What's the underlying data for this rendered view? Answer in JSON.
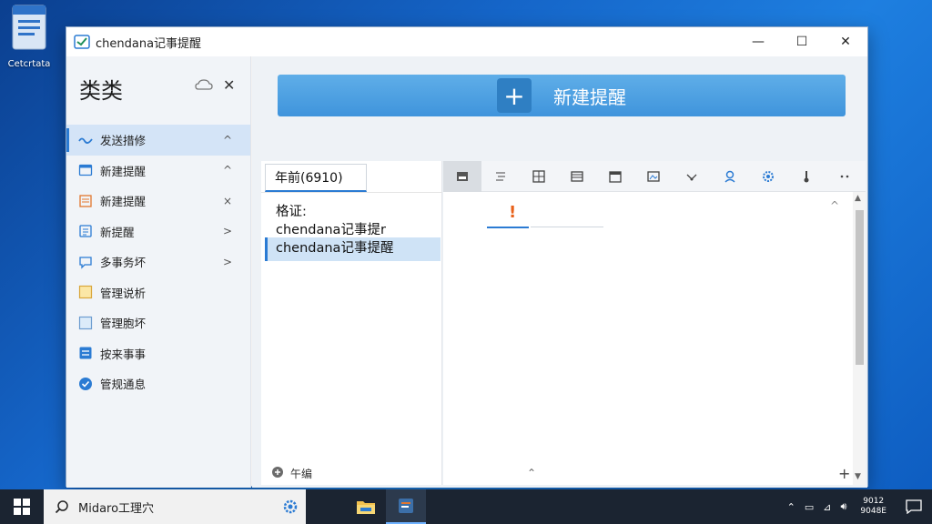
{
  "desktop": {
    "icon_label": "Cetcrtata"
  },
  "window": {
    "title": "chendana记事提醒"
  },
  "sidebar": {
    "title": "类类",
    "items": [
      {
        "label": "发送措修",
        "chev": "^",
        "icon": "wave-icon",
        "active": true
      },
      {
        "label": "新建提醒",
        "chev": "^",
        "icon": "calendar-icon"
      },
      {
        "label": "新建提醒",
        "chev": "×",
        "icon": "list-icon"
      },
      {
        "label": "新提醒",
        "chev": ">",
        "icon": "checklist-icon"
      },
      {
        "label": "多事务坏",
        "chev": ">",
        "icon": "chat-icon"
      },
      {
        "label": "管理说析",
        "chev": "",
        "icon": "note-icon"
      },
      {
        "label": "管理胞坏",
        "chev": "",
        "icon": "folder-icon"
      },
      {
        "label": "按来事事",
        "chev": "",
        "icon": "doc-icon"
      },
      {
        "label": "管规通息",
        "chev": "",
        "icon": "check-icon"
      }
    ]
  },
  "main": {
    "new_button_label": "新建提醒",
    "tab_label": "年前(6910)",
    "list": {
      "line1": "格证:",
      "line2": "chendana记事提r",
      "selected": "chendana记事提醒"
    },
    "footer_label": "午编"
  },
  "taskbar": {
    "search_text": "Midaro工理穴",
    "clock_time": "9012",
    "clock_date": "9048E"
  },
  "colors": {
    "accent": "#2b7bd3",
    "button": "#3f94dc",
    "warning": "#e8611a"
  }
}
